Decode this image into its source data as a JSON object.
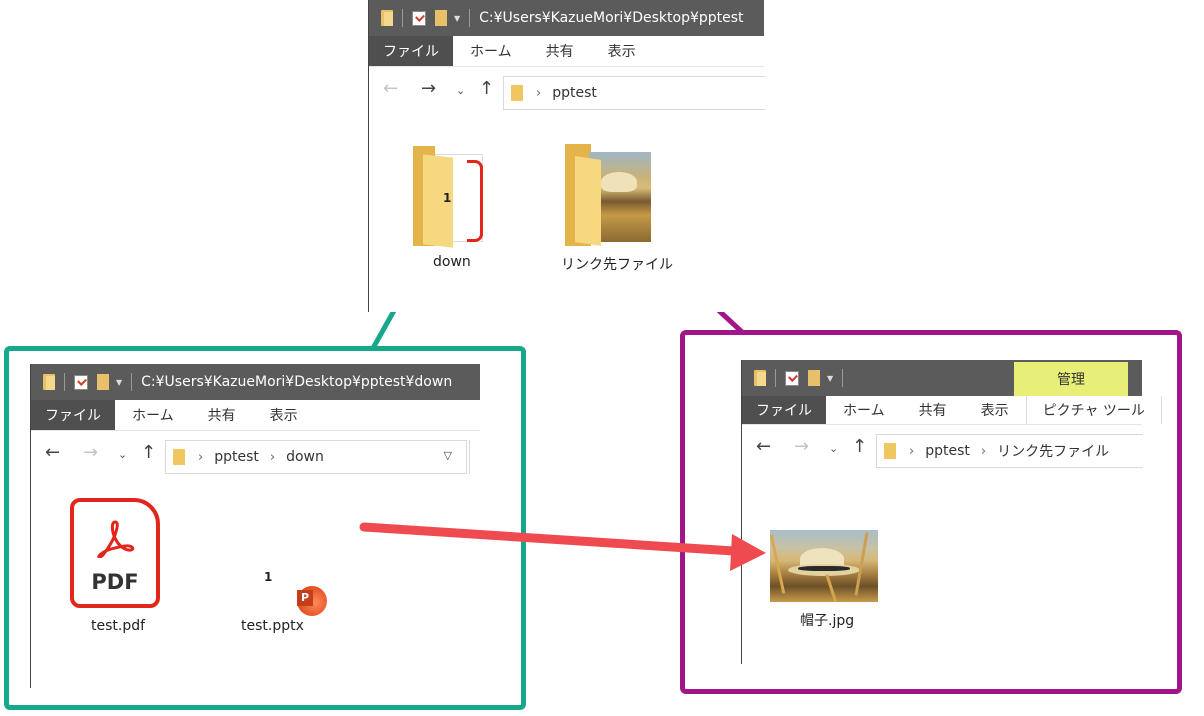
{
  "explorer_main": {
    "title_path": "C:¥Users¥KazueMori¥Desktop¥pptest",
    "ribbon_tabs": [
      "ファイル",
      "ホーム",
      "共有",
      "表示"
    ],
    "breadcrumb": [
      "pptest"
    ],
    "items": [
      {
        "name": "down",
        "icon": "folder-icon",
        "badge": "1"
      },
      {
        "name": "リンク先ファイル",
        "icon": "folder-photo-icon"
      }
    ]
  },
  "explorer_down": {
    "title_path": "C:¥Users¥KazueMori¥Desktop¥pptest¥down",
    "ribbon_tabs": [
      "ファイル",
      "ホーム",
      "共有",
      "表示"
    ],
    "breadcrumb": [
      "pptest",
      "down"
    ],
    "items": [
      {
        "name": "test.pdf",
        "icon": "pdf-icon",
        "icon_text": "PDF"
      },
      {
        "name": "test.pptx",
        "icon": "powerpoint-icon",
        "badge": "1",
        "icon_text": "P"
      }
    ]
  },
  "explorer_link": {
    "ribbon_tabs": [
      "ファイル",
      "ホーム",
      "共有",
      "表示"
    ],
    "context_group": "管理",
    "context_tab": "ピクチャ ツール",
    "breadcrumb": [
      "pptest",
      "リンク先ファイル"
    ],
    "items": [
      {
        "name": "帽子.jpg",
        "icon": "image-thumbnail-icon"
      }
    ]
  },
  "colors": {
    "teal_frame": "#16a88a",
    "purple_frame": "#a0158a",
    "arrow_red": "#ef4a4f",
    "titlebar": "#5b5b5b",
    "context_yellow": "#e8ef78"
  }
}
